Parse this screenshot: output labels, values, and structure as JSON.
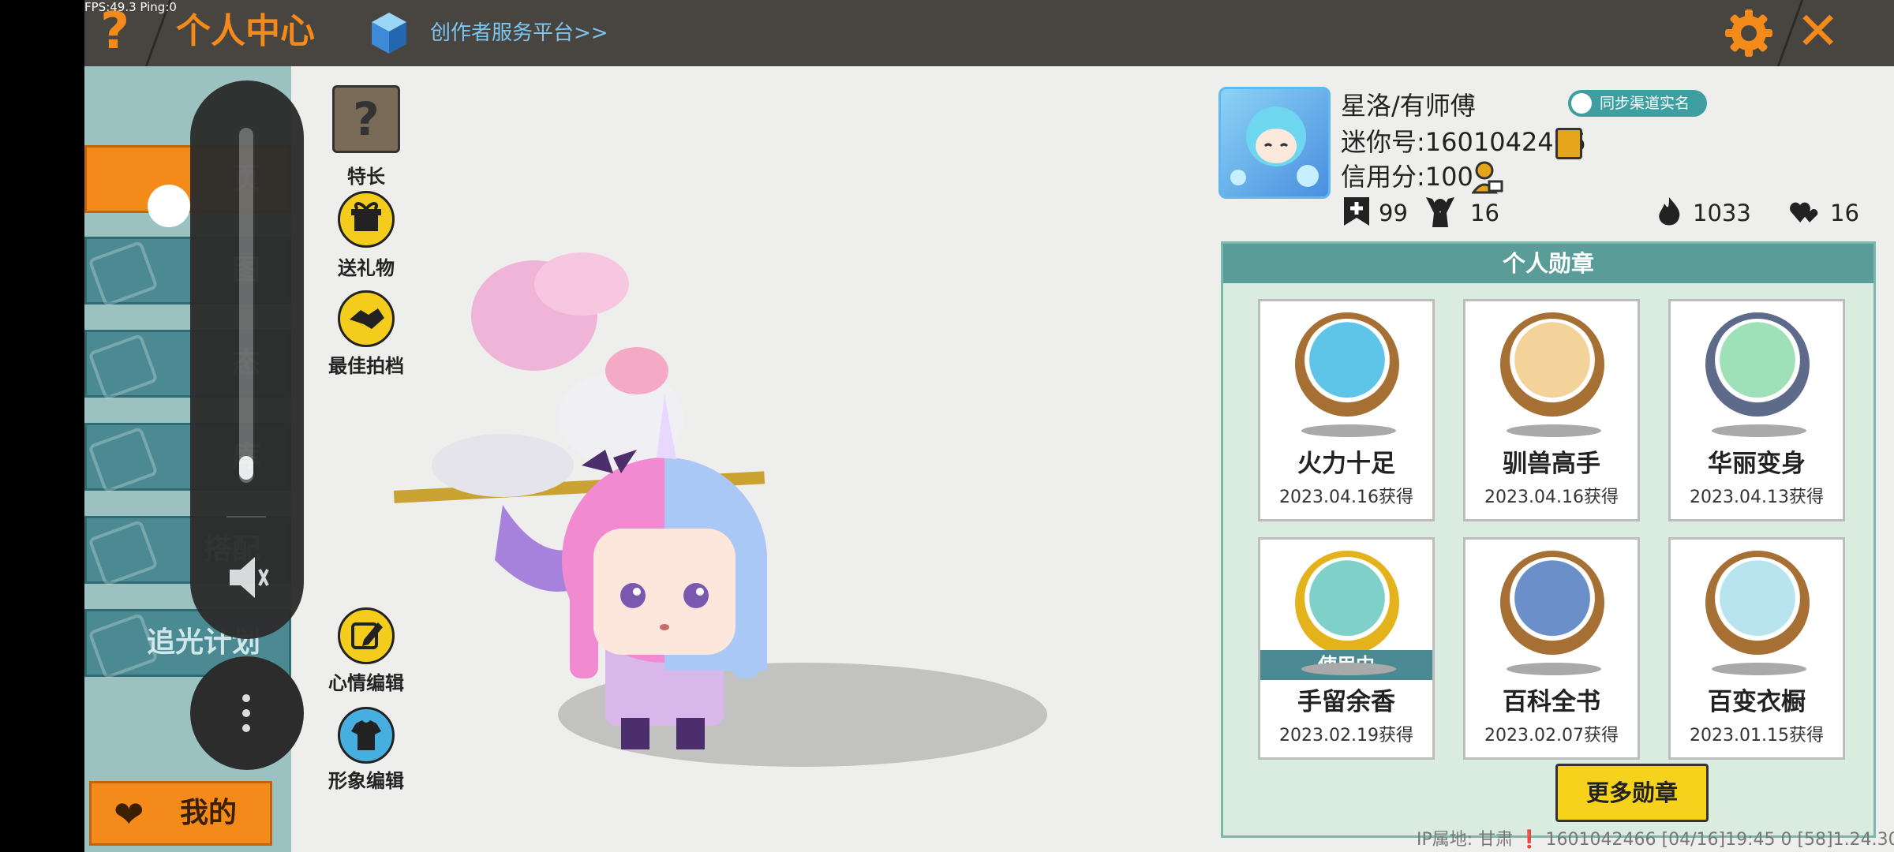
{
  "status": {
    "fps": "FPS:49.3  Ping:0"
  },
  "header": {
    "help_icon": "?",
    "title": "个人中心",
    "creator_link": "创作者服务平台>>",
    "close_icon": "✕",
    "accent": "#f48a1a"
  },
  "sidebar": {
    "items": [
      {
        "label": "页"
      },
      {
        "label": "图"
      },
      {
        "label": "态"
      },
      {
        "label": "库"
      },
      {
        "label": "搭配"
      },
      {
        "label": "追光计划"
      }
    ],
    "mine_button": "我的"
  },
  "actions": [
    {
      "label": "特长"
    },
    {
      "label": "送礼物"
    },
    {
      "label": "最佳拍档"
    },
    {
      "label": "心情编辑"
    },
    {
      "label": "形象编辑"
    }
  ],
  "profile": {
    "nickname": "星洛/有师傅",
    "sync_badge": "同步渠道实名",
    "mini_id": "迷你号:1601042466",
    "credit": "信用分:100",
    "stats": [
      {
        "icon": "plus-icon",
        "value": "99"
      },
      {
        "icon": "fans-icon",
        "value": "16"
      },
      {
        "icon": "flame-icon",
        "value": "1033"
      },
      {
        "icon": "hearts-icon",
        "value": "16"
      }
    ]
  },
  "medals": {
    "title": "个人勋章",
    "items": [
      {
        "name": "火力十足",
        "date": "2023.04.16获得",
        "ring": "#a66f33",
        "fill": "#5ec4e8"
      },
      {
        "name": "驯兽高手",
        "date": "2023.04.16获得",
        "ring": "#a66f33",
        "fill": "#f4d39a"
      },
      {
        "name": "华丽变身",
        "date": "2023.04.13获得",
        "ring": "#5d6a8a",
        "fill": "#9ee0b8"
      },
      {
        "name": "手留余香",
        "date": "2023.02.19获得",
        "ring": "#e4b21b",
        "fill": "#7fd0c8",
        "badge": "使用中"
      },
      {
        "name": "百科全书",
        "date": "2023.02.07获得",
        "ring": "#a66f33",
        "fill": "#6a8fc9"
      },
      {
        "name": "百变衣橱",
        "date": "2023.01.15获得",
        "ring": "#a66f33",
        "fill": "#b8e4f0"
      }
    ],
    "more_button": "更多勋章"
  },
  "footer": {
    "text": "IP属地: 甘肃 ❗   1601042466    [04/16]19:45 0   [58]1.24.30"
  }
}
